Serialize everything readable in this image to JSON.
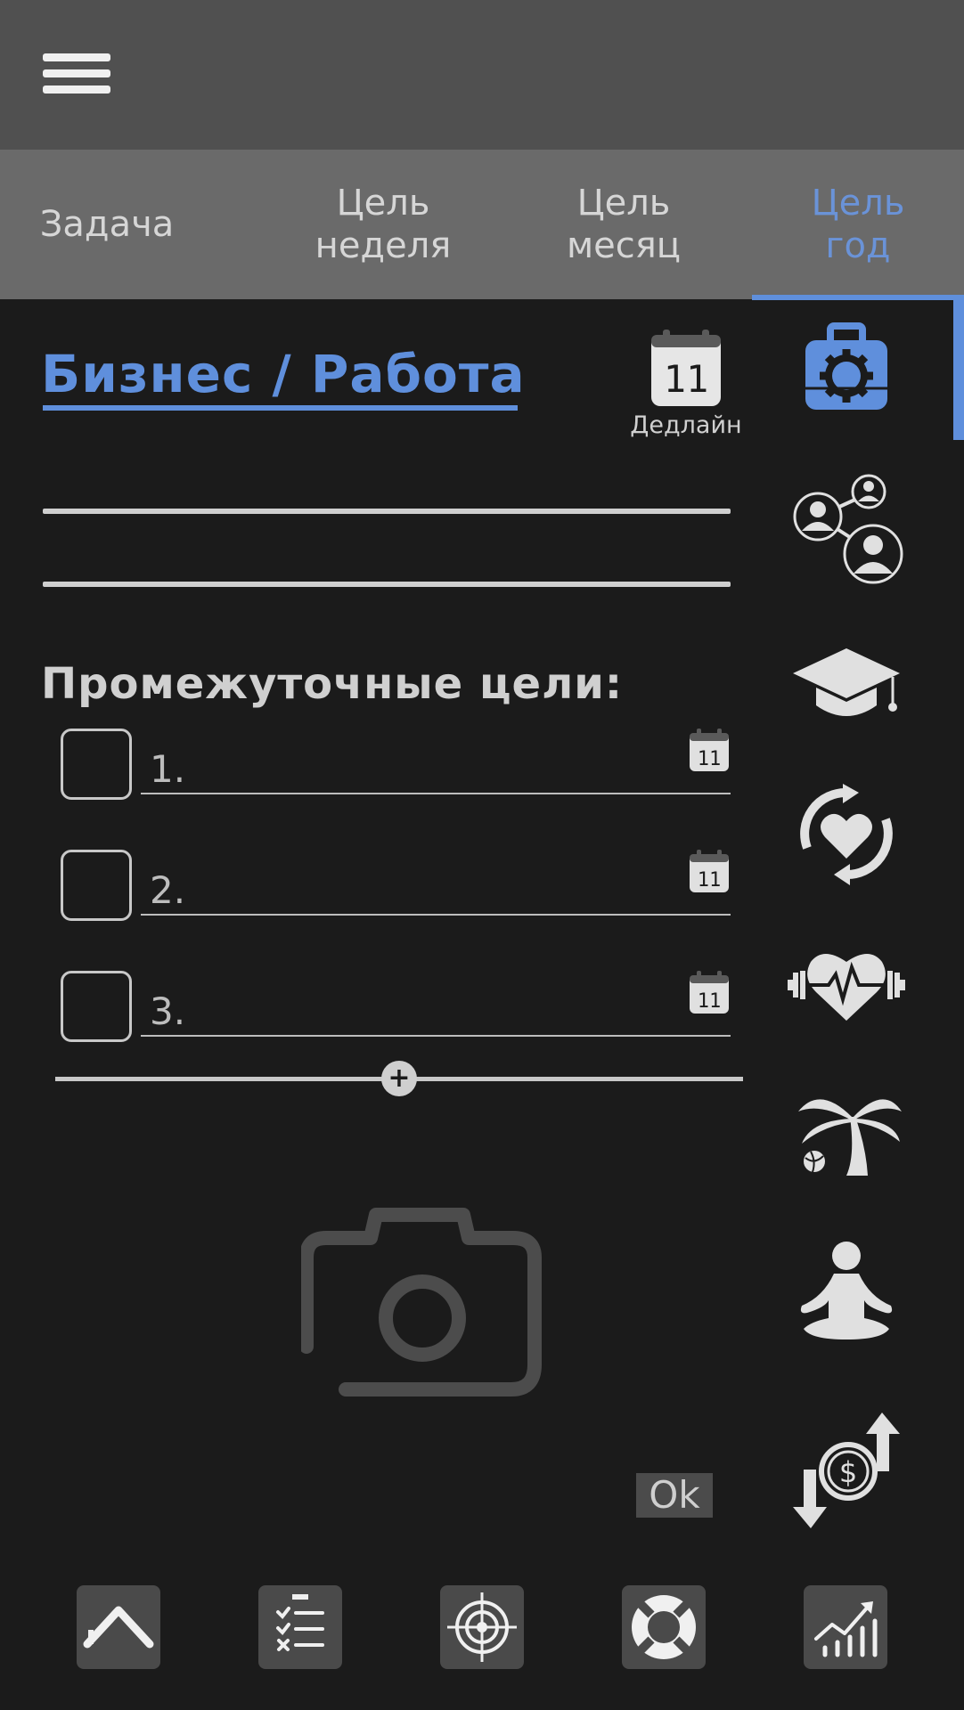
{
  "header": {
    "menu_icon": "hamburger-menu-icon"
  },
  "tabs": [
    {
      "label": "Задача",
      "active": false
    },
    {
      "label": "Цель\nнеделя",
      "active": false
    },
    {
      "label": "Цель\nмесяц",
      "active": false
    },
    {
      "label": "Цель\nгод",
      "active": true
    }
  ],
  "category": {
    "title": "Бизнес / Работа"
  },
  "deadline": {
    "day": "11",
    "label": "Дедлайн"
  },
  "subgoals": {
    "heading": "Промежуточные цели:",
    "items": [
      {
        "number": "1.",
        "day": "11",
        "checked": false
      },
      {
        "number": "2.",
        "day": "11",
        "checked": false
      },
      {
        "number": "3.",
        "day": "11",
        "checked": false
      }
    ]
  },
  "ok_button": {
    "label": "Ok"
  },
  "sidebar_icons": [
    "business-briefcase-icon",
    "relationships-network-icon",
    "education-cap-icon",
    "self-care-heart-icon",
    "fitness-health-icon",
    "vacation-palm-icon",
    "meditation-icon",
    "finance-money-icon"
  ],
  "bottom_nav_icons": [
    "home-icon",
    "checklist-icon",
    "target-icon",
    "lifebuoy-icon",
    "growth-chart-icon"
  ],
  "colors": {
    "accent": "#5f8fdc",
    "background": "#1b1b1b",
    "topbar": "#505050",
    "tabbar": "#6a6a6a"
  }
}
